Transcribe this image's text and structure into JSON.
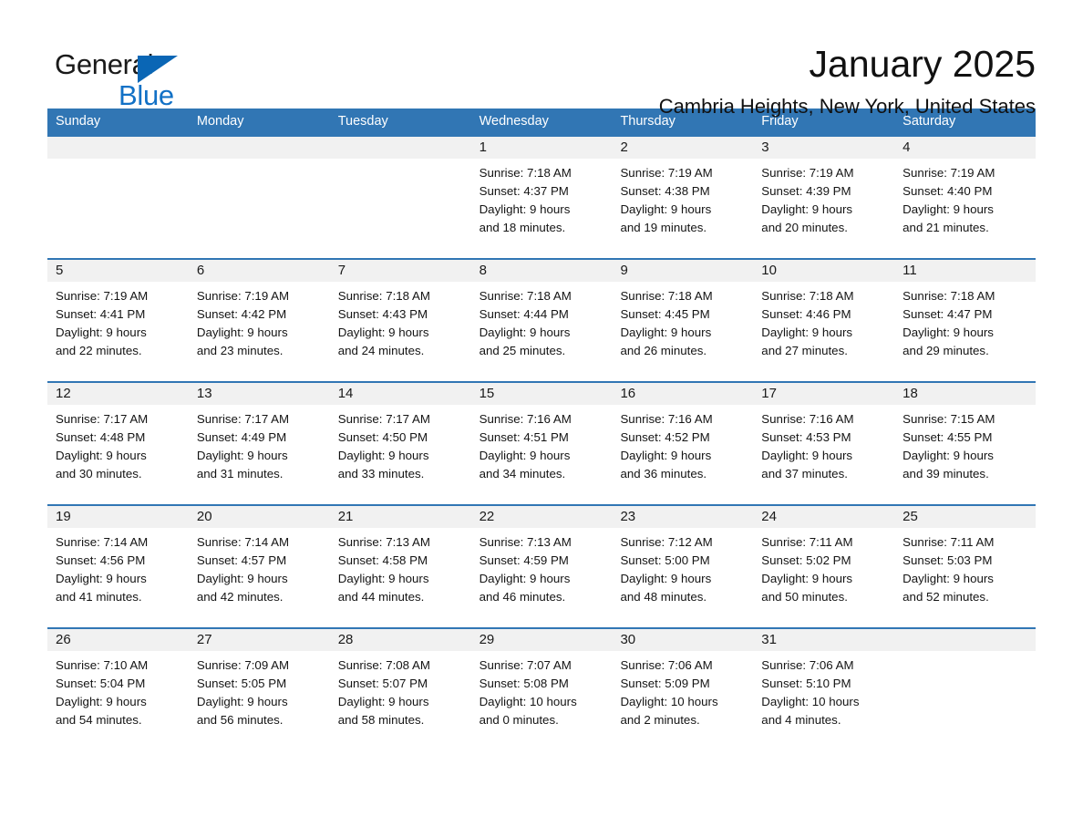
{
  "brand": {
    "name_part1": "General",
    "name_part2": "Blue",
    "triangle_color": "#0a66b5",
    "blue_color": "#1271c6"
  },
  "header": {
    "title": "January 2025",
    "subtitle": "Cambria Heights, New York, United States"
  },
  "theme": {
    "header_blue": "#3176b4",
    "day_band_gray": "#f1f1f1",
    "text": "#141414"
  },
  "weekdays": [
    "Sunday",
    "Monday",
    "Tuesday",
    "Wednesday",
    "Thursday",
    "Friday",
    "Saturday"
  ],
  "weeks": [
    [
      {
        "day": "",
        "info": ""
      },
      {
        "day": "",
        "info": ""
      },
      {
        "day": "",
        "info": ""
      },
      {
        "day": "1",
        "info": "Sunrise: 7:18 AM\nSunset: 4:37 PM\nDaylight: 9 hours\nand 18 minutes."
      },
      {
        "day": "2",
        "info": "Sunrise: 7:19 AM\nSunset: 4:38 PM\nDaylight: 9 hours\nand 19 minutes."
      },
      {
        "day": "3",
        "info": "Sunrise: 7:19 AM\nSunset: 4:39 PM\nDaylight: 9 hours\nand 20 minutes."
      },
      {
        "day": "4",
        "info": "Sunrise: 7:19 AM\nSunset: 4:40 PM\nDaylight: 9 hours\nand 21 minutes."
      }
    ],
    [
      {
        "day": "5",
        "info": "Sunrise: 7:19 AM\nSunset: 4:41 PM\nDaylight: 9 hours\nand 22 minutes."
      },
      {
        "day": "6",
        "info": "Sunrise: 7:19 AM\nSunset: 4:42 PM\nDaylight: 9 hours\nand 23 minutes."
      },
      {
        "day": "7",
        "info": "Sunrise: 7:18 AM\nSunset: 4:43 PM\nDaylight: 9 hours\nand 24 minutes."
      },
      {
        "day": "8",
        "info": "Sunrise: 7:18 AM\nSunset: 4:44 PM\nDaylight: 9 hours\nand 25 minutes."
      },
      {
        "day": "9",
        "info": "Sunrise: 7:18 AM\nSunset: 4:45 PM\nDaylight: 9 hours\nand 26 minutes."
      },
      {
        "day": "10",
        "info": "Sunrise: 7:18 AM\nSunset: 4:46 PM\nDaylight: 9 hours\nand 27 minutes."
      },
      {
        "day": "11",
        "info": "Sunrise: 7:18 AM\nSunset: 4:47 PM\nDaylight: 9 hours\nand 29 minutes."
      }
    ],
    [
      {
        "day": "12",
        "info": "Sunrise: 7:17 AM\nSunset: 4:48 PM\nDaylight: 9 hours\nand 30 minutes."
      },
      {
        "day": "13",
        "info": "Sunrise: 7:17 AM\nSunset: 4:49 PM\nDaylight: 9 hours\nand 31 minutes."
      },
      {
        "day": "14",
        "info": "Sunrise: 7:17 AM\nSunset: 4:50 PM\nDaylight: 9 hours\nand 33 minutes."
      },
      {
        "day": "15",
        "info": "Sunrise: 7:16 AM\nSunset: 4:51 PM\nDaylight: 9 hours\nand 34 minutes."
      },
      {
        "day": "16",
        "info": "Sunrise: 7:16 AM\nSunset: 4:52 PM\nDaylight: 9 hours\nand 36 minutes."
      },
      {
        "day": "17",
        "info": "Sunrise: 7:16 AM\nSunset: 4:53 PM\nDaylight: 9 hours\nand 37 minutes."
      },
      {
        "day": "18",
        "info": "Sunrise: 7:15 AM\nSunset: 4:55 PM\nDaylight: 9 hours\nand 39 minutes."
      }
    ],
    [
      {
        "day": "19",
        "info": "Sunrise: 7:14 AM\nSunset: 4:56 PM\nDaylight: 9 hours\nand 41 minutes."
      },
      {
        "day": "20",
        "info": "Sunrise: 7:14 AM\nSunset: 4:57 PM\nDaylight: 9 hours\nand 42 minutes."
      },
      {
        "day": "21",
        "info": "Sunrise: 7:13 AM\nSunset: 4:58 PM\nDaylight: 9 hours\nand 44 minutes."
      },
      {
        "day": "22",
        "info": "Sunrise: 7:13 AM\nSunset: 4:59 PM\nDaylight: 9 hours\nand 46 minutes."
      },
      {
        "day": "23",
        "info": "Sunrise: 7:12 AM\nSunset: 5:00 PM\nDaylight: 9 hours\nand 48 minutes."
      },
      {
        "day": "24",
        "info": "Sunrise: 7:11 AM\nSunset: 5:02 PM\nDaylight: 9 hours\nand 50 minutes."
      },
      {
        "day": "25",
        "info": "Sunrise: 7:11 AM\nSunset: 5:03 PM\nDaylight: 9 hours\nand 52 minutes."
      }
    ],
    [
      {
        "day": "26",
        "info": "Sunrise: 7:10 AM\nSunset: 5:04 PM\nDaylight: 9 hours\nand 54 minutes."
      },
      {
        "day": "27",
        "info": "Sunrise: 7:09 AM\nSunset: 5:05 PM\nDaylight: 9 hours\nand 56 minutes."
      },
      {
        "day": "28",
        "info": "Sunrise: 7:08 AM\nSunset: 5:07 PM\nDaylight: 9 hours\nand 58 minutes."
      },
      {
        "day": "29",
        "info": "Sunrise: 7:07 AM\nSunset: 5:08 PM\nDaylight: 10 hours\nand 0 minutes."
      },
      {
        "day": "30",
        "info": "Sunrise: 7:06 AM\nSunset: 5:09 PM\nDaylight: 10 hours\nand 2 minutes."
      },
      {
        "day": "31",
        "info": "Sunrise: 7:06 AM\nSunset: 5:10 PM\nDaylight: 10 hours\nand 4 minutes."
      },
      {
        "day": "",
        "info": ""
      }
    ]
  ]
}
